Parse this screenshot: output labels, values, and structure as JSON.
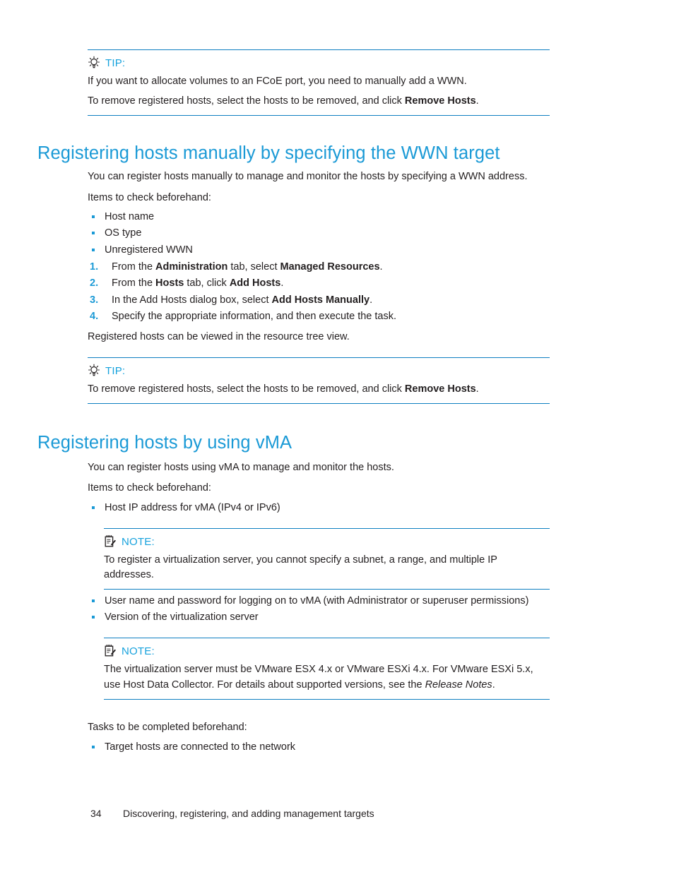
{
  "page": {
    "number": "34",
    "footer_title": "Discovering, registering, and adding management targets"
  },
  "tip1": {
    "icon": "lightbulb-icon",
    "label": "TIP:",
    "line1": "If you want to allocate volumes to an FCoE port, you need to manually add a WWN.",
    "line2_prefix": "To remove registered hosts, select the hosts to be removed, and click ",
    "line2_bold": "Remove Hosts",
    "line2_suffix": "."
  },
  "section1": {
    "heading": "Registering hosts manually by specifying the WWN target",
    "intro": "You can register hosts manually to manage and monitor the hosts by specifying a WWN address.",
    "checklist_label": "Items to check beforehand:",
    "bullets": [
      "Host name",
      "OS type",
      "Unregistered WWN"
    ],
    "steps": [
      {
        "num": "1.",
        "pre": "From the ",
        "bold1": "Administration",
        "mid": " tab, select ",
        "bold2": "Managed Resources",
        "post": "."
      },
      {
        "num": "2.",
        "pre": "From the ",
        "bold1": "Hosts",
        "mid": " tab, click ",
        "bold2": "Add Hosts",
        "post": "."
      },
      {
        "num": "3.",
        "pre": "In the Add Hosts dialog box, select ",
        "bold1": "",
        "mid": "",
        "bold2": "Add Hosts Manually",
        "post": "."
      },
      {
        "num": "4.",
        "pre": "Specify the appropriate information, and then execute the task.",
        "bold1": "",
        "mid": "",
        "bold2": "",
        "post": ""
      }
    ],
    "closing": "Registered hosts can be viewed in the resource tree view."
  },
  "tip2": {
    "icon": "lightbulb-icon",
    "label": "TIP:",
    "line1_prefix": "To remove registered hosts, select the hosts to be removed, and click ",
    "line1_bold": "Remove Hosts",
    "line1_suffix": "."
  },
  "section2": {
    "heading": "Registering hosts by using vMA",
    "intro": "You can register hosts using vMA to manage and monitor the hosts.",
    "checklist_label": "Items to check beforehand:",
    "bullets_before_note1": [
      "Host IP address for vMA (IPv4 or IPv6)"
    ],
    "note1": {
      "icon": "notepad-icon",
      "label": "NOTE:",
      "text": "To register a virtualization server, you cannot specify a subnet, a range, and multiple IP addresses."
    },
    "bullets_after_note1": [
      "User name and password for logging on to vMA (with Administrator or superuser permissions)",
      "Version of the virtualization server"
    ],
    "note2": {
      "icon": "notepad-icon",
      "label": "NOTE:",
      "line1": "The virtualization server must be VMware ESX 4.x or VMware ESXi 4.x. For VMware ESXi 5.x,",
      "line2_prefix": "use Host Data Collector. For details about supported versions, see the ",
      "line2_italic": "Release Notes",
      "line2_suffix": "."
    },
    "tasks_label": "Tasks to be completed beforehand:",
    "tasks_bullets": [
      "Target hosts are connected to the network"
    ]
  },
  "colors": {
    "heading_blue": "#1b9ad6",
    "rule_blue": "#0e7fc1",
    "label_blue": "#17a2dd",
    "body_black": "#231f20"
  }
}
